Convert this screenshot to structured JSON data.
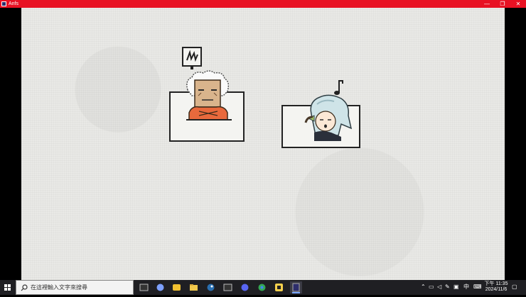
{
  "window": {
    "title": "Anfs",
    "minimize_glyph": "—",
    "maximize_glyph": "❐",
    "close_glyph": "✕"
  },
  "game": {
    "characters": [
      {
        "name": "grandpa",
        "status_icon": "broken-speech-bubble-icon"
      },
      {
        "name": "girl",
        "status_icon": "music-note-icon"
      }
    ]
  },
  "taskbar": {
    "search_placeholder": "在這裡輸入文字來搜尋",
    "apps": [
      "terminal-icon",
      "discord-icon",
      "game-icon",
      "file-explorer-icon",
      "steam-icon",
      "terminal2-icon",
      "chat-icon",
      "chrome-icon",
      "pinned-app-icon",
      "active-game-icon"
    ],
    "tray": {
      "ime": "中",
      "time": "下午 11:35",
      "date": "2024/11/6"
    }
  }
}
